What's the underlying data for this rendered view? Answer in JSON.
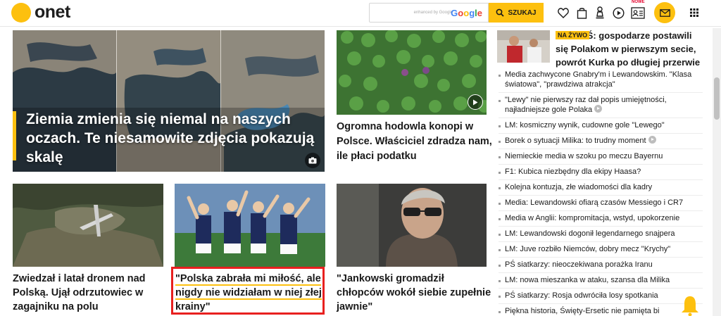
{
  "header": {
    "logo": "onet",
    "search_placeholder": "",
    "search_brand": "enhanced by Google",
    "google_label": "Google",
    "search_button": "SZUKAJ",
    "nowe_badge": "NOWE",
    "icons": [
      "heart-icon",
      "bag-icon",
      "chess-icon",
      "play-circle-icon",
      "id-card-icon",
      "mail-icon",
      "apps-grid-icon"
    ]
  },
  "hero": {
    "title": "Ziemia zmienia się niemal na naszych oczach. Te niesamowite zdjęcia pokazują skalę"
  },
  "tile_hemp": {
    "title": "Ogromna hodowla konopi w Polsce. Właściciel zdradza nam, ile płaci podatku"
  },
  "tile_drone": {
    "title": "Zwiedzał i latał dronem nad Polską. Ujął odrzutowiec w zagajniku na polu"
  },
  "tile_football": {
    "title": "\"Polska zabrała mi miłość, ale nigdy nie widziałam w niej złej krainy\""
  },
  "tile_jankowski": {
    "title": "\"Jankowski gromadził chłopców wokół siebie zupełnie jawnie\""
  },
  "sidebar": {
    "live_badge": "NA ŻYWO",
    "live_title": "PŚ: gospodarze postawili się Polakom w pierwszym secie, powrót Kurka po długiej przerwie",
    "news": [
      {
        "text": "Media zachwycone Gnabry'm i Lewandowskim. \"Klasa światowa\", \"prawdziwa atrakcja\"",
        "video": false
      },
      {
        "text": "\"Lewy\" nie pierwszy raz dał popis umiejętności, najładniejsze gole Polaka",
        "video": true
      },
      {
        "text": "LM: kosmiczny wynik, cudowne gole \"Lewego\"",
        "video": false
      },
      {
        "text": "Borek o sytuacji Milika: to trudny moment",
        "video": true
      },
      {
        "text": "Niemieckie media w szoku po meczu Bayernu",
        "video": false
      },
      {
        "text": "F1: Kubica niezbędny dla ekipy Haasa?",
        "video": false
      },
      {
        "text": "Kolejna kontuzja, złe wiadomości dla kadry",
        "video": false
      },
      {
        "text": "Media: Lewandowski ofiarą czasów Messiego i CR7",
        "video": false
      },
      {
        "text": "Media w Anglii: kompromitacja, wstyd, upokorzenie",
        "video": false
      },
      {
        "text": "LM: Lewandowski dogonił legendarnego snajpera",
        "video": false
      },
      {
        "text": "LM: Juve rozbiło Niemców, dobry mecz \"Krychy\"",
        "video": false
      },
      {
        "text": "PŚ siatkarzy: nieoczekiwana porażka Iranu",
        "video": false
      },
      {
        "text": "LM: nowa mieszanka w ataku, szansa dla Milika",
        "video": false
      },
      {
        "text": "PŚ siatkarzy: Rosja odwróciła losy spotkania",
        "video": false
      },
      {
        "text": "Piękna historia, Święty-Ersetic nie pamięta bi",
        "video": false
      }
    ]
  },
  "colors": {
    "brand": "#fdc00f",
    "highlight_box": "#e8201f"
  }
}
